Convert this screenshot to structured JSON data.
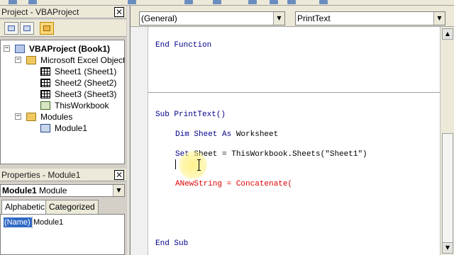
{
  "project_explorer": {
    "title": "Project - VBAProject",
    "tree": [
      {
        "label": "VBAProject (Book1)",
        "bold": true
      },
      {
        "label": "Microsoft Excel Objects"
      },
      {
        "label": "Sheet1 (Sheet1)"
      },
      {
        "label": "Sheet2 (Sheet2)"
      },
      {
        "label": "Sheet3 (Sheet3)"
      },
      {
        "label": "ThisWorkbook"
      },
      {
        "label": "Modules"
      },
      {
        "label": "Module1"
      }
    ]
  },
  "properties": {
    "title": "Properties - Module1",
    "object_name": "Module1",
    "object_type": "Module",
    "tabs": [
      "Alphabetic",
      "Categorized"
    ],
    "rows": [
      {
        "name": "(Name)",
        "value": "Module1"
      }
    ]
  },
  "code_window": {
    "object_combo": "(General)",
    "proc_combo": "PrintText",
    "lines": {
      "l1": "End Function",
      "l2": "Sub PrintText()",
      "l3a": "Dim Sheet As ",
      "l3b": "Worksheet",
      "l4a": "Set ",
      "l4b": "Sheet = ThisWorkbook.Sheets(\"Sheet1\")",
      "l5": "ANewString = Concatenate(",
      "l6": "End Sub"
    }
  },
  "colors": {
    "keyword": "#00008b",
    "error": "#e00000",
    "selection": "#316ac5"
  }
}
